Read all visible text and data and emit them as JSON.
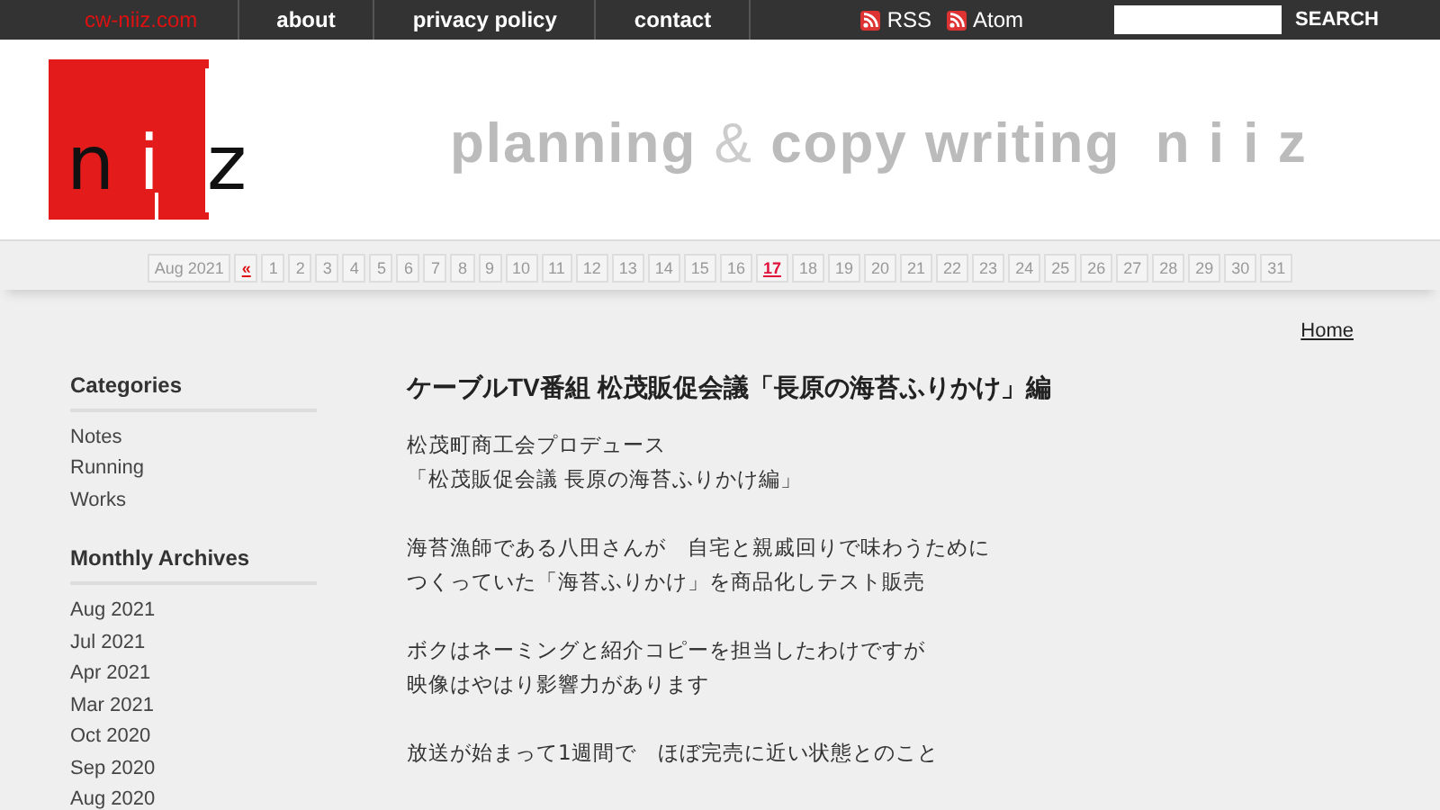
{
  "top_nav": {
    "site": "cw-niiz.com",
    "links": [
      "about",
      "privacy policy",
      "contact"
    ],
    "feeds": [
      "RSS",
      "Atom"
    ],
    "search": {
      "button": "SEARCH"
    }
  },
  "header": {
    "logo_letters": [
      "n",
      "i",
      "z"
    ],
    "tagline": "planning **&** copy writing  n i i z"
  },
  "calendar": {
    "month": "Aug 2021",
    "prev": "«",
    "days": [
      {
        "label": "1",
        "has_post": false
      },
      {
        "label": "2",
        "has_post": false
      },
      {
        "label": "3",
        "has_post": false
      },
      {
        "label": "4",
        "has_post": false
      },
      {
        "label": "5",
        "has_post": false
      },
      {
        "label": "6",
        "has_post": false
      },
      {
        "label": "7",
        "has_post": false
      },
      {
        "label": "8",
        "has_post": false
      },
      {
        "label": "9",
        "has_post": false
      },
      {
        "label": "10",
        "has_post": false
      },
      {
        "label": "11",
        "has_post": false
      },
      {
        "label": "12",
        "has_post": false
      },
      {
        "label": "13",
        "has_post": false
      },
      {
        "label": "14",
        "has_post": false
      },
      {
        "label": "15",
        "has_post": false
      },
      {
        "label": "16",
        "has_post": false
      },
      {
        "label": "17",
        "has_post": true
      },
      {
        "label": "18",
        "has_post": false
      },
      {
        "label": "19",
        "has_post": false
      },
      {
        "label": "20",
        "has_post": false
      },
      {
        "label": "21",
        "has_post": false
      },
      {
        "label": "22",
        "has_post": false
      },
      {
        "label": "23",
        "has_post": false
      },
      {
        "label": "24",
        "has_post": false
      },
      {
        "label": "25",
        "has_post": false
      },
      {
        "label": "26",
        "has_post": false
      },
      {
        "label": "27",
        "has_post": false
      },
      {
        "label": "28",
        "has_post": false
      },
      {
        "label": "29",
        "has_post": false
      },
      {
        "label": "30",
        "has_post": false
      },
      {
        "label": "31",
        "has_post": false
      }
    ]
  },
  "breadcrumb": "Home",
  "sidebar": [
    {
      "title": "Categories",
      "items": [
        "Notes",
        "Running",
        "Works"
      ]
    },
    {
      "title": "Monthly Archives",
      "items": [
        "Aug 2021",
        "Jul 2021",
        "Apr 2021",
        "Mar 2021",
        "Oct 2020",
        "Sep 2020",
        "Aug 2020"
      ]
    }
  ],
  "post": {
    "title": "ケーブルTV番組 松茂販促会議「長原の海苔ふりかけ」編",
    "paragraphs": [
      [
        "松茂町商工会プロデュース",
        "「松茂販促会議 長原の海苔ふりかけ編」"
      ],
      [
        "海苔漁師である八田さんが　自宅と親戚回りで味わうために",
        "つくっていた「海苔ふりかけ」を商品化しテスト販売"
      ],
      [
        "ボクはネーミングと紹介コピーを担当したわけですが",
        "映像はやはり影響力があります"
      ],
      [
        "放送が始まって1週間で　ほぼ完売に近い状態とのこと"
      ]
    ]
  }
}
